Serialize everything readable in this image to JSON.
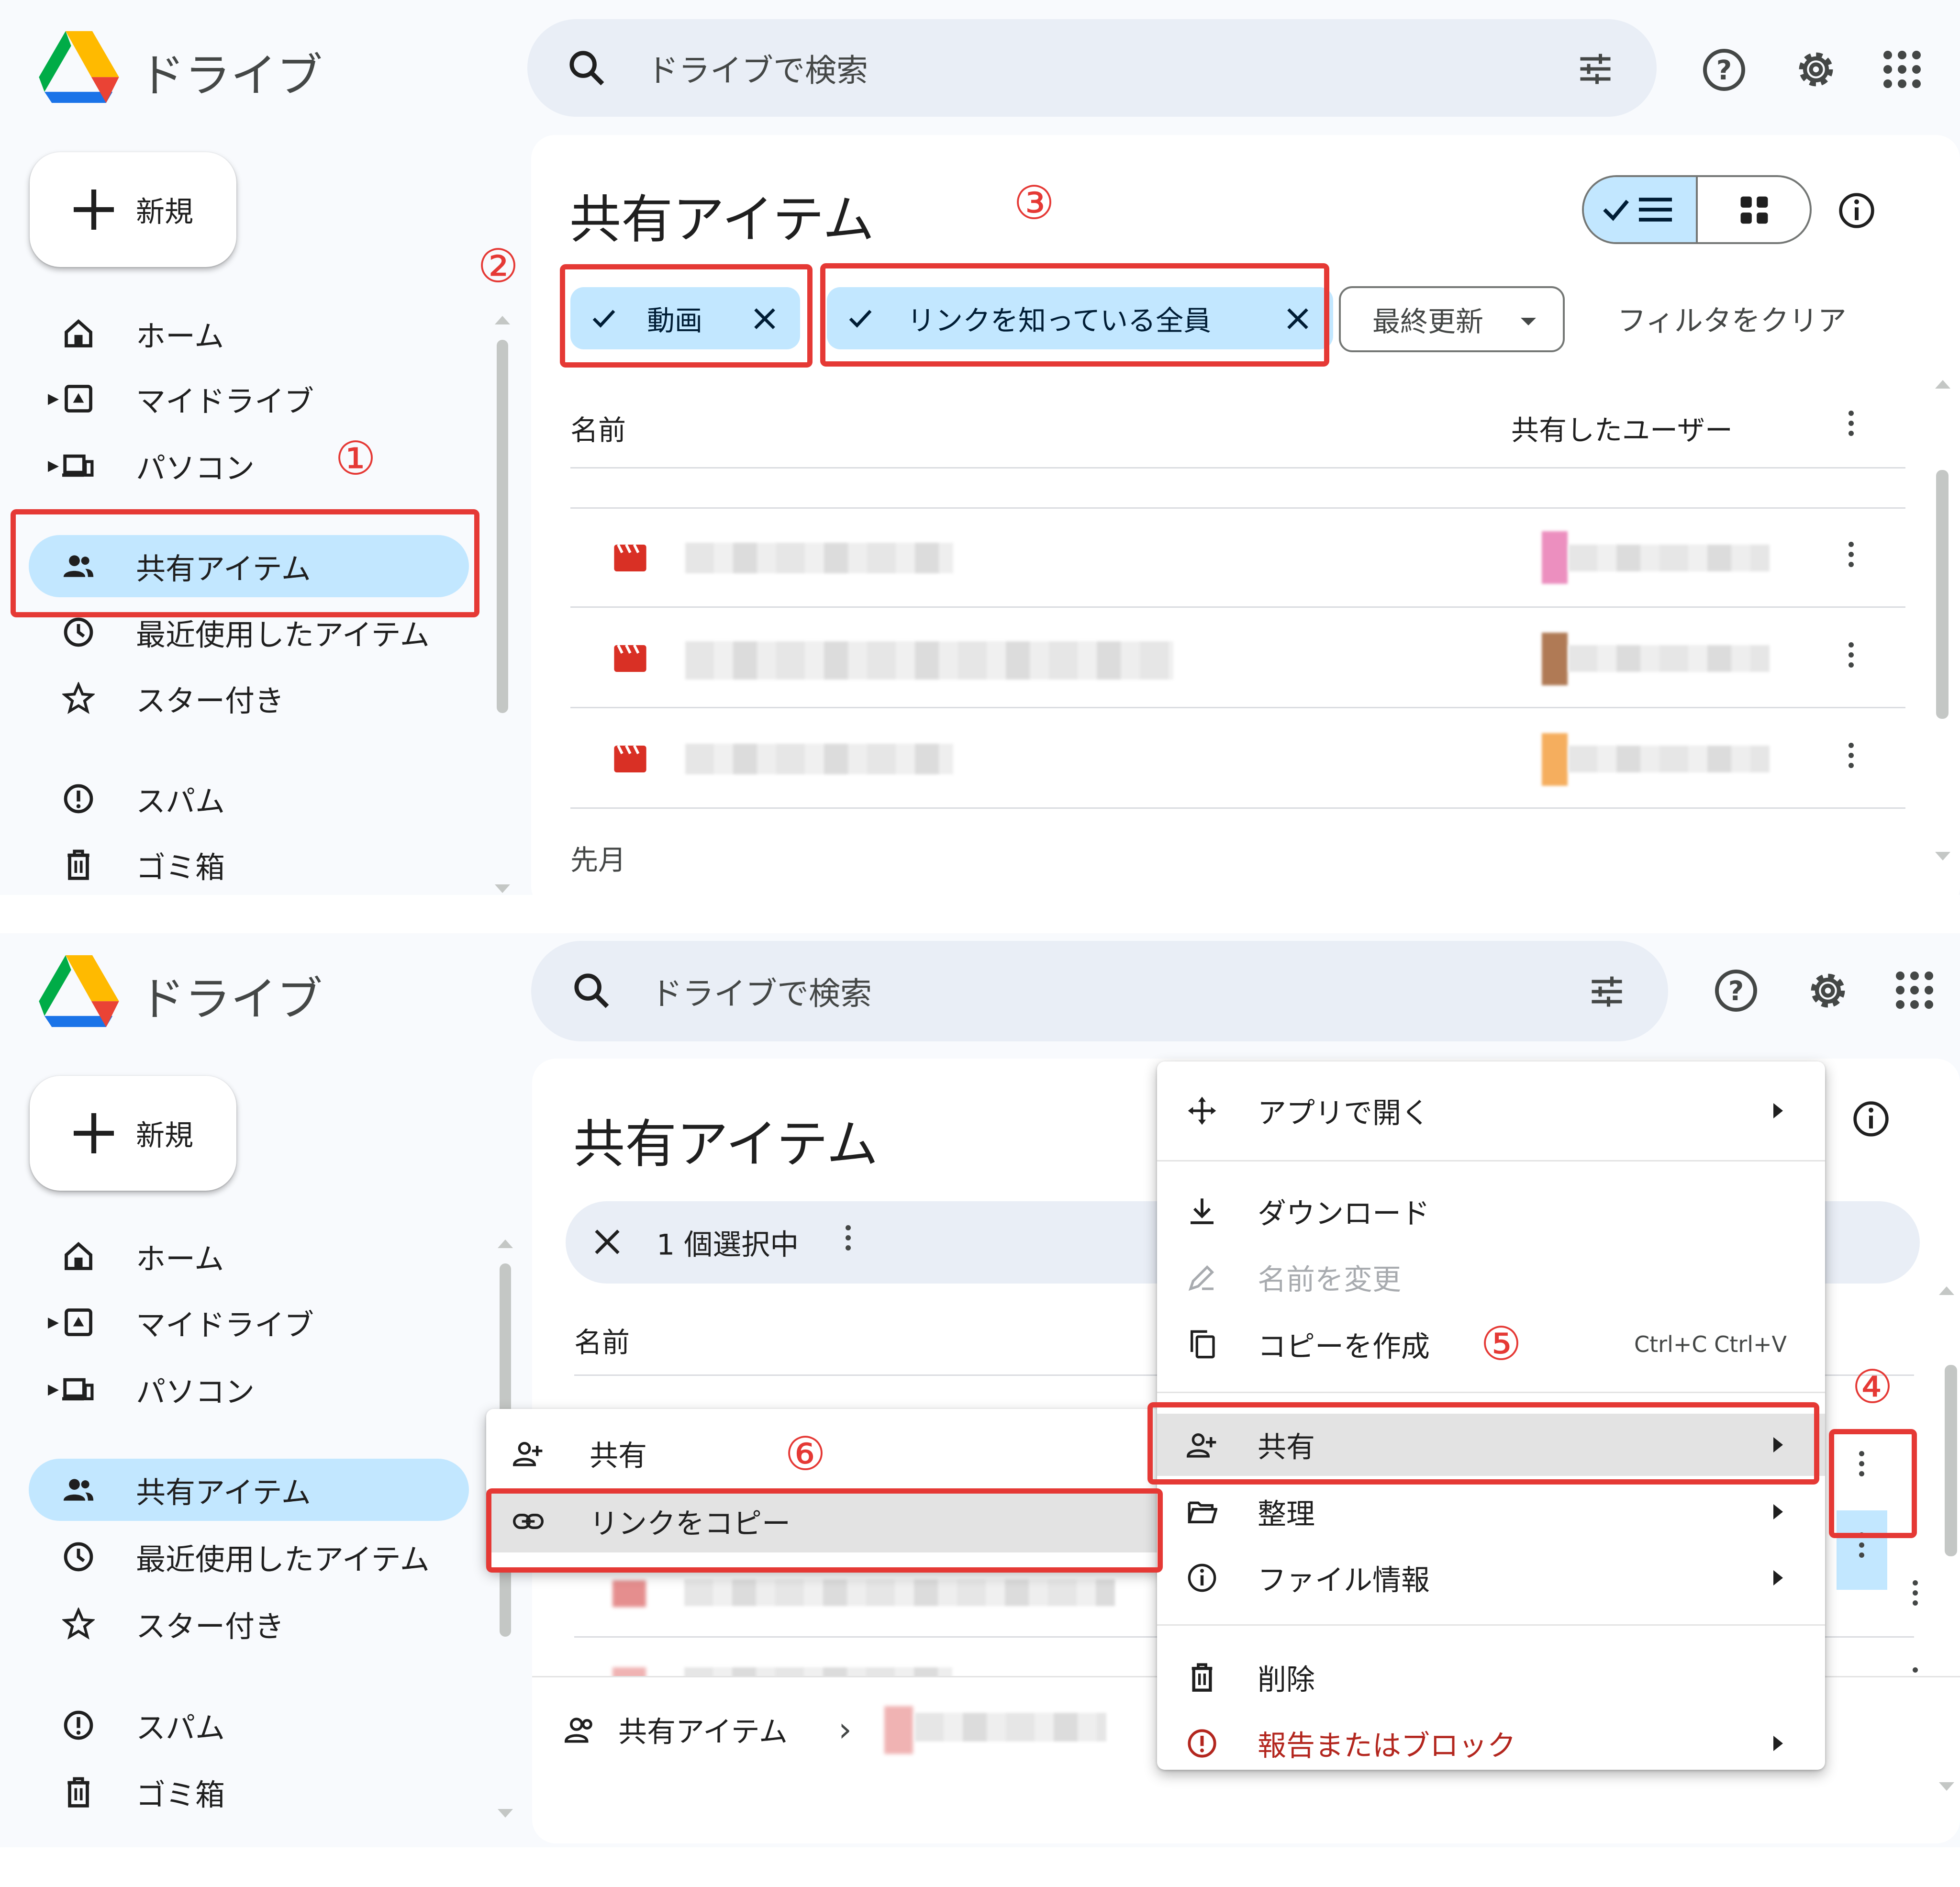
{
  "app": {
    "title": "ドライブ"
  },
  "search": {
    "placeholder": "ドライブで検索"
  },
  "new_button": {
    "label": "新規"
  },
  "nav": {
    "home": "ホーム",
    "my_drive": "マイドライブ",
    "computers": "パソコン",
    "shared": "共有アイテム",
    "recent": "最近使用したアイテム",
    "starred": "スター付き",
    "spam": "スパム",
    "trash": "ゴミ箱"
  },
  "page": {
    "title": "共有アイテム"
  },
  "filters": {
    "type_chip": "動画",
    "access_chip": "リンクを知っている全員",
    "modified_chip": "最終更新",
    "clear": "フィルタをクリア"
  },
  "table": {
    "col_name": "名前",
    "col_shared_by": "共有したユーザー",
    "section_last_month": "先月"
  },
  "selection": {
    "count_label": "1 個選択中"
  },
  "breadcrumb": {
    "label": "共有アイテム"
  },
  "context_menu": {
    "open_with": "アプリで開く",
    "download": "ダウンロード",
    "rename": "名前を変更",
    "make_copy": "コピーを作成",
    "shortcut": "Ctrl+C Ctrl+V",
    "share": "共有",
    "organize": "整理",
    "file_info": "ファイル情報",
    "delete": "削除",
    "report": "報告またはブロック"
  },
  "share_submenu": {
    "share": "共有",
    "copy_link": "リンクをコピー"
  },
  "annotations": {
    "n1": "①",
    "n2": "②",
    "n3": "③",
    "n4": "④",
    "n5": "⑤",
    "n6": "⑥"
  },
  "colors": {
    "accent": "#c2e7ff",
    "annotation": "#e53935",
    "danger": "#b3261e",
    "video_icon": "#d93025"
  }
}
